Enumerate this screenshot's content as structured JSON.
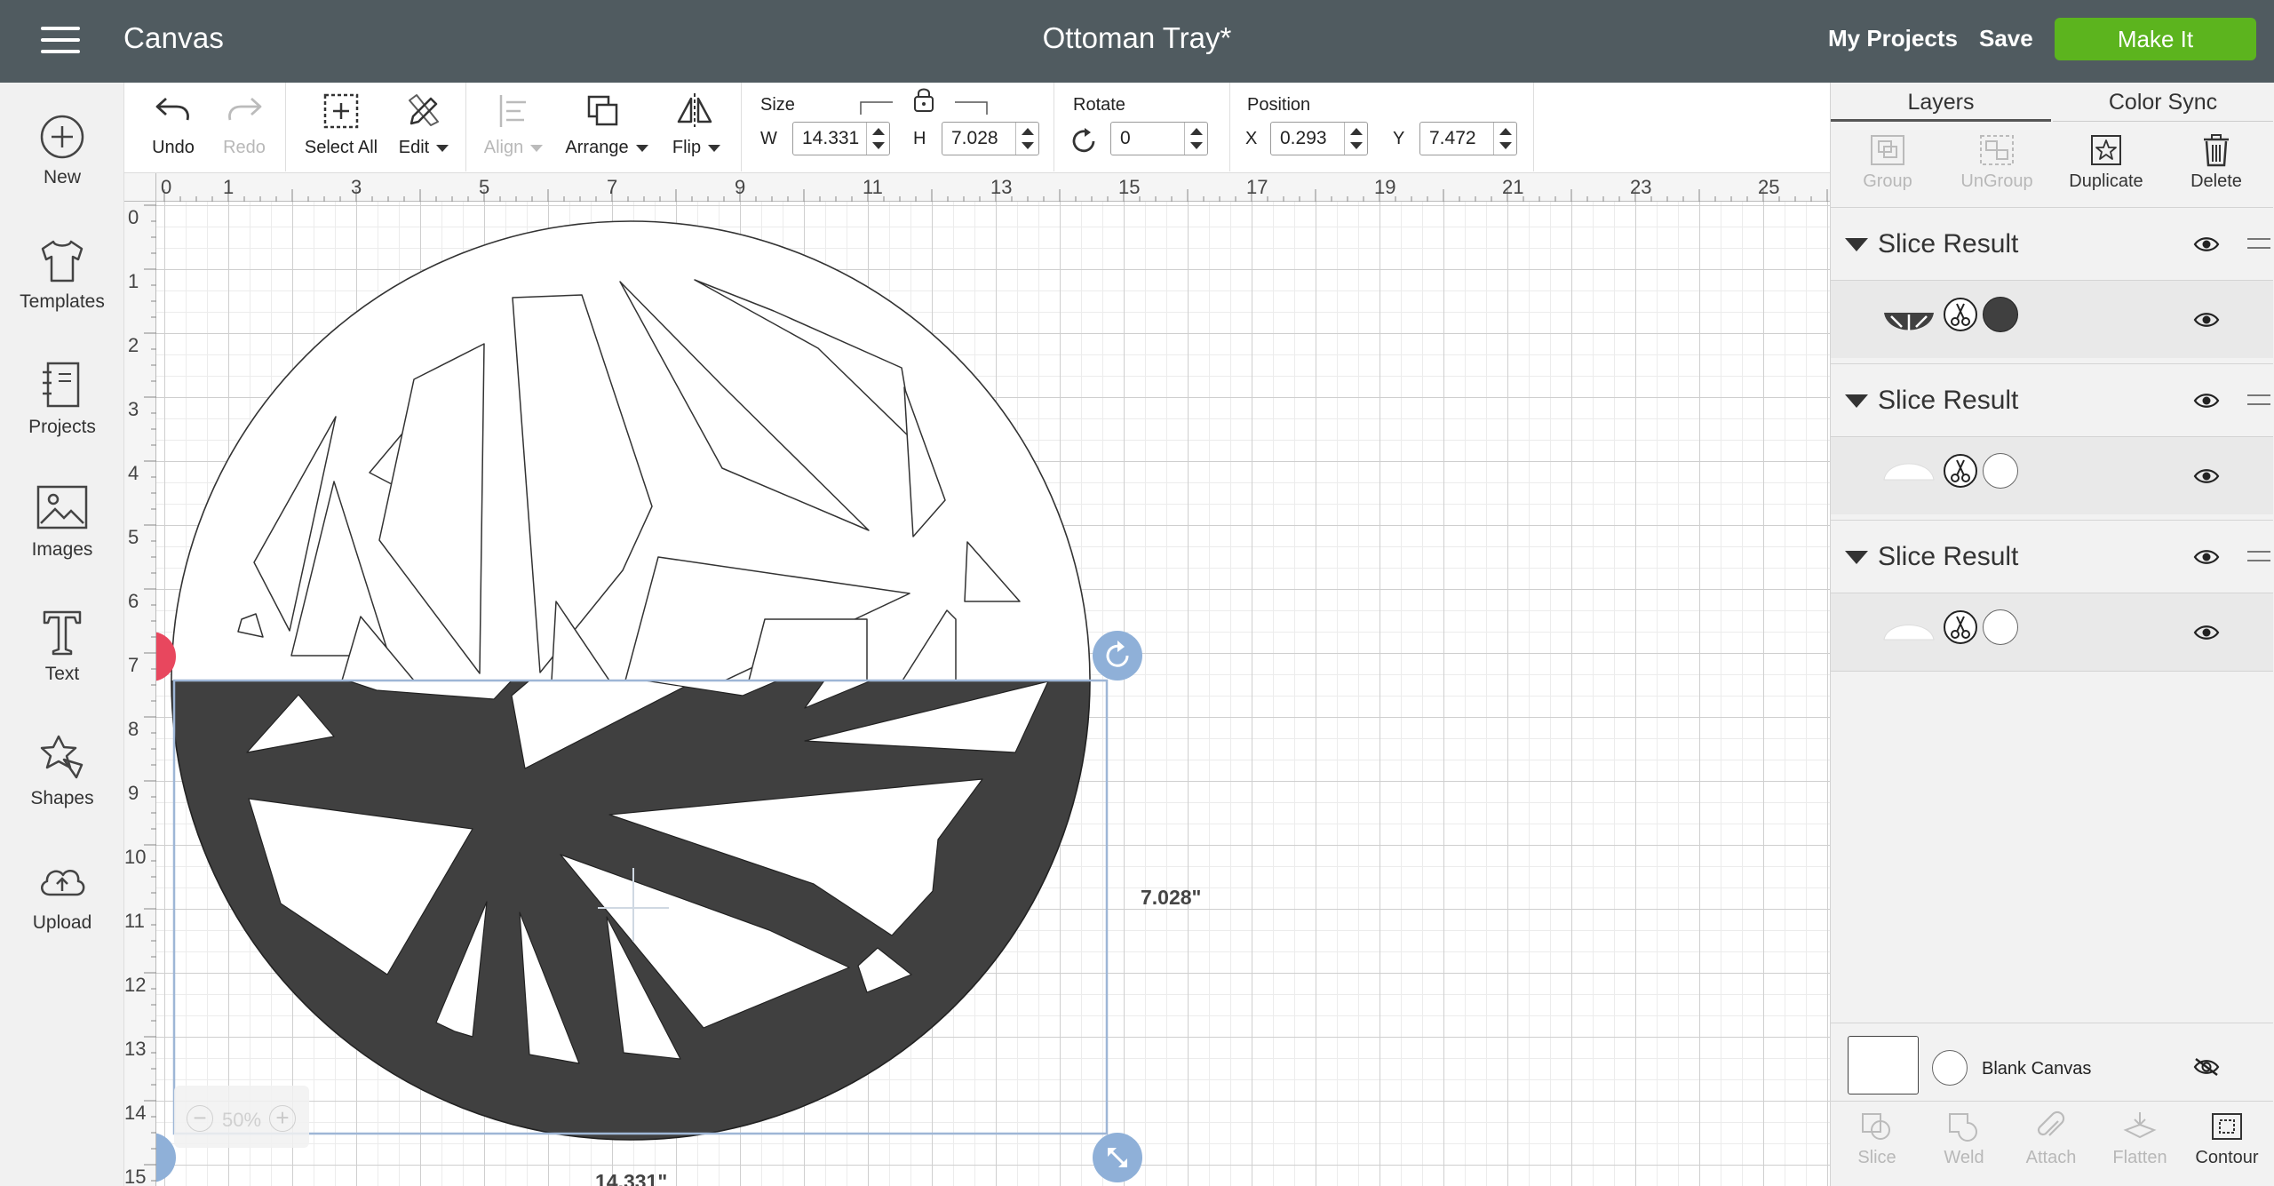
{
  "header": {
    "app_title": "Canvas",
    "project_title": "Ottoman Tray*",
    "my_projects": "My Projects",
    "save": "Save",
    "make_it": "Make It"
  },
  "sidebar": {
    "items": [
      {
        "label": "New",
        "icon": "plus-circle-icon"
      },
      {
        "label": "Templates",
        "icon": "tshirt-icon"
      },
      {
        "label": "Projects",
        "icon": "notebook-icon"
      },
      {
        "label": "Images",
        "icon": "image-icon"
      },
      {
        "label": "Text",
        "icon": "text-t-icon"
      },
      {
        "label": "Shapes",
        "icon": "shapes-icon"
      },
      {
        "label": "Upload",
        "icon": "cloud-upload-icon"
      }
    ]
  },
  "toolbar": {
    "undo": "Undo",
    "redo": "Redo",
    "select_all": "Select All",
    "edit": "Edit",
    "align": "Align",
    "arrange": "Arrange",
    "flip": "Flip",
    "size_title": "Size",
    "w_label": "W",
    "w_value": "14.331",
    "h_label": "H",
    "h_value": "7.028",
    "rotate_title": "Rotate",
    "rotate_value": "0",
    "position_title": "Position",
    "x_label": "X",
    "x_value": "0.293",
    "y_label": "Y",
    "y_value": "7.472"
  },
  "rulers": {
    "top": [
      "0",
      "1",
      "3",
      "5",
      "7",
      "9",
      "11",
      "13",
      "15",
      "17",
      "19",
      "21",
      "23",
      "25"
    ],
    "left": [
      "0",
      "1",
      "2",
      "3",
      "4",
      "5",
      "6",
      "7",
      "8",
      "9",
      "10",
      "11",
      "12",
      "13",
      "14",
      "15"
    ]
  },
  "canvas": {
    "height_dim": "7.028\"",
    "width_dim": "14.331\"",
    "zoom": "50%",
    "zoom_minus": "−",
    "zoom_plus": "+",
    "colors": {
      "dark_fill": "#404040",
      "selection": "#9eb6d6",
      "handle_blue": "#8fb0d8",
      "handle_red": "#e8475e"
    }
  },
  "panel": {
    "tabs": [
      "Layers",
      "Color Sync"
    ],
    "layer_tools": [
      {
        "label": "Group",
        "enabled": false
      },
      {
        "label": "UnGroup",
        "enabled": false
      },
      {
        "label": "Duplicate",
        "enabled": true
      },
      {
        "label": "Delete",
        "enabled": true
      }
    ],
    "groups": [
      {
        "name": "Slice Result",
        "swatch": "#404040",
        "swatch_type": "filled"
      },
      {
        "name": "Slice Result",
        "swatch": "#ffffff",
        "swatch_type": "outline"
      },
      {
        "name": "Slice Result",
        "swatch": "#ffffff",
        "swatch_type": "outline"
      }
    ],
    "blank_canvas": "Blank Canvas",
    "bottom_tools": [
      {
        "label": "Slice",
        "enabled": false
      },
      {
        "label": "Weld",
        "enabled": false
      },
      {
        "label": "Attach",
        "enabled": false
      },
      {
        "label": "Flatten",
        "enabled": false
      },
      {
        "label": "Contour",
        "enabled": true
      }
    ]
  }
}
